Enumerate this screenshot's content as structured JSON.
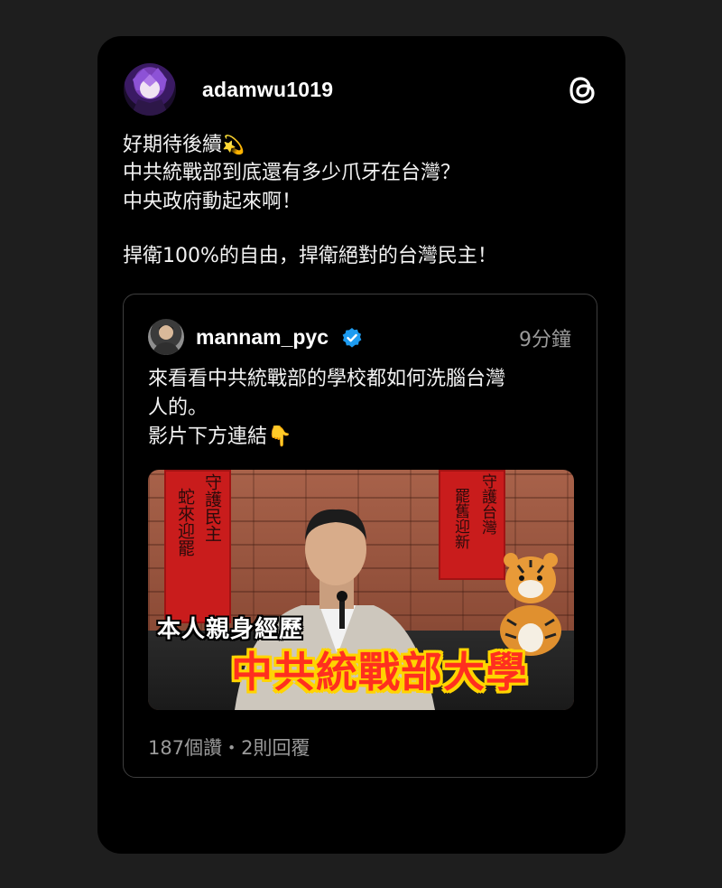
{
  "post": {
    "username": "adamwu1019",
    "lines": [
      "好期待後續",
      "中共統戰部到底還有多少爪牙在台灣？",
      "中央政府動起來啊！",
      "",
      "捍衛100%的自由，捍衛絕對的台灣民主！"
    ],
    "line0_emoji": "💫",
    "logo_icon": "threads-logo-icon"
  },
  "quoted": {
    "username": "mannam_pyc",
    "verified_icon": "verified-badge-icon",
    "time": "9分鐘",
    "lines": [
      "來看看中共統戰部的學校都如何洗腦台灣",
      "人的。",
      "影片下方連結"
    ],
    "line2_emoji": "👇",
    "video": {
      "couplet_left": [
        "守護民主",
        "蛇來迎罷"
      ],
      "couplet_right": [
        "守護台灣",
        "罷舊迎新"
      ],
      "caption_small": "本人親身經歷",
      "caption_big": "中共統戰部大學"
    },
    "stats": "187個讚・2則回覆"
  },
  "colors": {
    "background": "#1e1e1e",
    "card": "#000000",
    "verified": "#1d9bf0",
    "muted_text": "#9a9a9a",
    "caption_red": "#ff2f1f",
    "caption_yellow": "#ffd400"
  }
}
